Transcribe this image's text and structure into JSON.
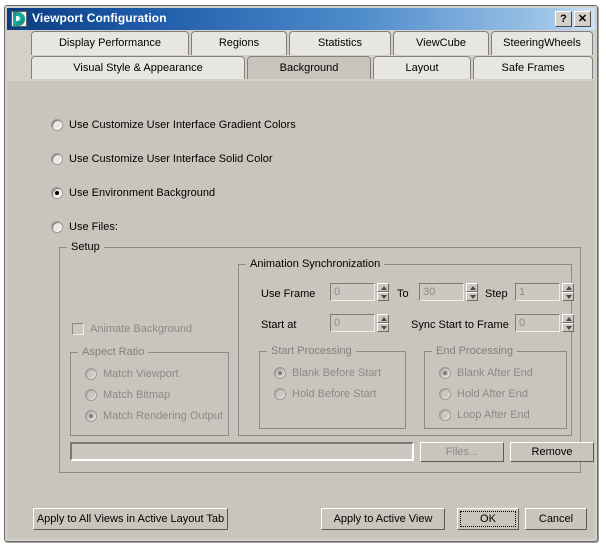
{
  "window": {
    "title": "Viewport Configuration",
    "icon": "max-logo-icon",
    "help_button": "?",
    "close_button": "✕"
  },
  "tabs": {
    "row1": [
      {
        "label": "Display Performance",
        "active": false
      },
      {
        "label": "Regions",
        "active": false
      },
      {
        "label": "Statistics",
        "active": false
      },
      {
        "label": "ViewCube",
        "active": false
      },
      {
        "label": "SteeringWheels",
        "active": false
      }
    ],
    "row2": [
      {
        "label": "Visual Style & Appearance",
        "active": false
      },
      {
        "label": "Background",
        "active": true
      },
      {
        "label": "Layout",
        "active": false
      },
      {
        "label": "Safe Frames",
        "active": false
      }
    ]
  },
  "background_mode": {
    "options": [
      {
        "label": "Use Customize User Interface Gradient Colors",
        "selected": false,
        "disabled": false
      },
      {
        "label": "Use Customize User Interface Solid Color",
        "selected": false,
        "disabled": false
      },
      {
        "label": "Use Environment Background",
        "selected": true,
        "disabled": false
      },
      {
        "label": "Use Files:",
        "selected": false,
        "disabled": false
      }
    ]
  },
  "setup": {
    "title": "Setup",
    "animate_background": {
      "label": "Animate Background",
      "checked": false,
      "disabled": true
    },
    "aspect_ratio": {
      "title": "Aspect Ratio",
      "options": [
        {
          "label": "Match Viewport",
          "selected": false
        },
        {
          "label": "Match Bitmap",
          "selected": false
        },
        {
          "label": "Match Rendering Output",
          "selected": true
        }
      ]
    },
    "animation_sync": {
      "title": "Animation Synchronization",
      "use_frame_label": "Use Frame",
      "use_frame_value": "0",
      "to_label": "To",
      "to_value": "30",
      "step_label": "Step",
      "step_value": "1",
      "start_at_label": "Start at",
      "start_at_value": "0",
      "sync_start_label": "Sync Start to Frame",
      "sync_start_value": "0"
    },
    "start_processing": {
      "title": "Start Processing",
      "options": [
        {
          "label": "Blank Before Start",
          "selected": true
        },
        {
          "label": "Hold Before Start",
          "selected": false
        }
      ]
    },
    "end_processing": {
      "title": "End Processing",
      "options": [
        {
          "label": "Blank After End",
          "selected": true
        },
        {
          "label": "Hold After End",
          "selected": false
        },
        {
          "label": "Loop After End",
          "selected": false
        }
      ]
    },
    "file_path_value": "",
    "files_button": "Files...",
    "remove_button": "Remove"
  },
  "footer": {
    "apply_all_views": "Apply to All Views in Active Layout Tab",
    "apply_active_view": "Apply to Active View",
    "ok": "OK",
    "cancel": "Cancel"
  }
}
